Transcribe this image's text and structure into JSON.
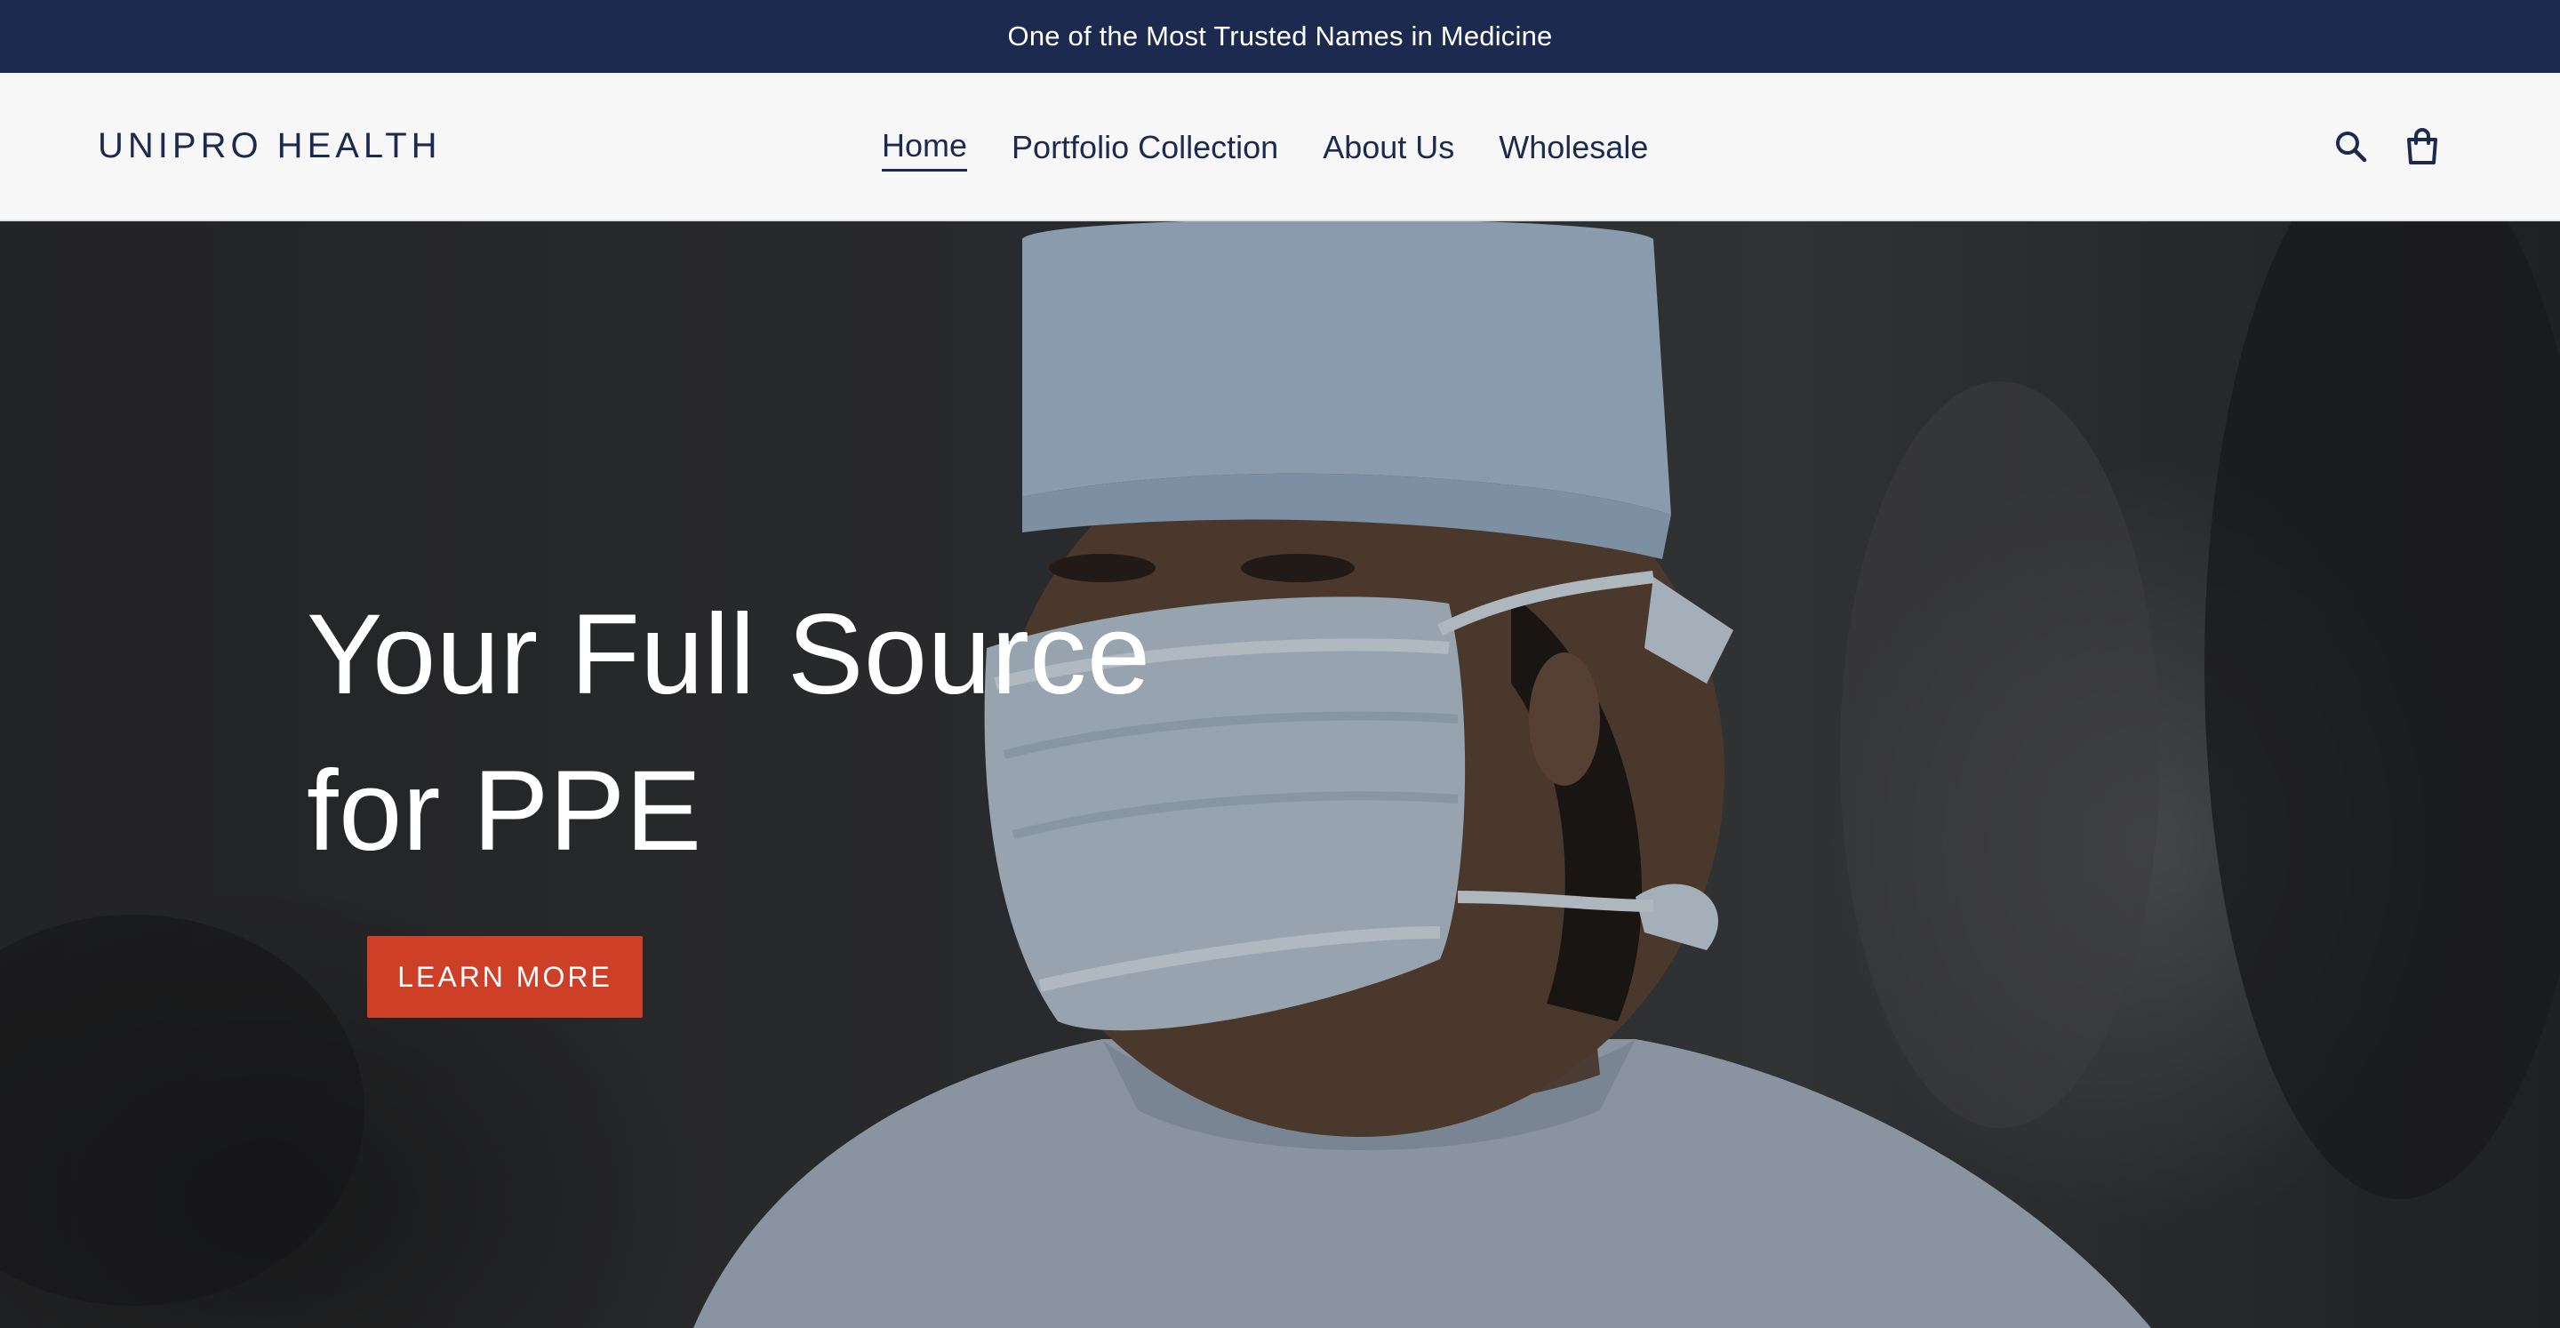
{
  "announcement": {
    "text": "One of the Most Trusted Names in Medicine"
  },
  "header": {
    "logo": "UNIPRO HEALTH",
    "nav": [
      {
        "label": "Home",
        "active": true
      },
      {
        "label": "Portfolio Collection",
        "active": false
      },
      {
        "label": "About Us",
        "active": false
      },
      {
        "label": "Wholesale",
        "active": false
      }
    ],
    "icons": [
      "search-icon",
      "cart-icon"
    ]
  },
  "hero": {
    "heading_line1": "Your Full Source",
    "heading_line2": "for PPE",
    "cta_label": "LEARN MORE"
  },
  "colors": {
    "announcement_bg": "#1b2a4e",
    "header_bg": "#f7f7f7",
    "brand_text": "#1b2a4e",
    "cta_bg": "#cd3f26"
  }
}
